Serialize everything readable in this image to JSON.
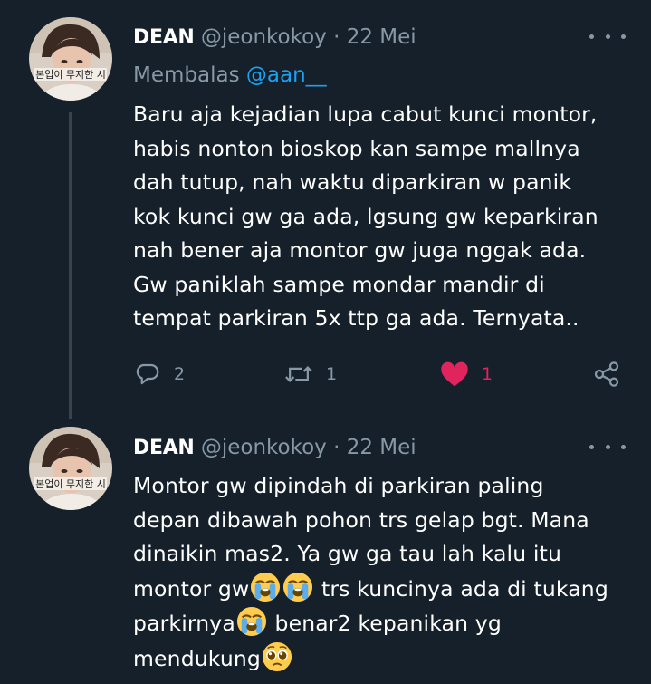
{
  "tweets": [
    {
      "display_name": "DEAN",
      "handle": "@jeonkokoy",
      "separator": "·",
      "date": "22 Mei",
      "reply_prefix": "Membalas",
      "reply_mention": "@aan__",
      "text_lines": [
        "Baru aja kejadian lupa cabut kunci montor,",
        "habis nonton bioskop kan sampe mallnya",
        "dah tutup, nah waktu diparkiran w panik",
        "kok kunci gw ga ada, lgsung gw keparkiran",
        "nah bener aja montor gw juga nggak ada.",
        "Gw paniklah sampe mondar mandir di",
        "tempat parkiran 5x ttp ga ada. Ternyata.."
      ],
      "reply_count": "2",
      "retweet_count": "1",
      "like_count": "1",
      "liked": true
    },
    {
      "display_name": "DEAN",
      "handle": "@jeonkokoy",
      "separator": "·",
      "date": "22 Mei",
      "text_lines": [
        "Montor gw dipindah di parkiran paling",
        "depan dibawah pohon trs gelap bgt. Mana",
        "dinaikin mas2. Ya gw ga tau lah kalu itu"
      ],
      "line4_a": "montor gw",
      "line4_b": " trs kuncinya ada di tukang",
      "line5_a": "parkirnya",
      "line5_b": " benar2 kepanikan yg",
      "line6_a": "mendukung"
    }
  ],
  "colors": {
    "background": "#15202b",
    "text": "#ffffff",
    "secondary": "#8899a6",
    "mention": "#1da1f2",
    "like": "#e0245e",
    "thread_line": "#38444d"
  },
  "icons": [
    "avatar",
    "more-dots-icon",
    "reply-icon",
    "retweet-icon",
    "heart-icon",
    "share-icon",
    "loudly-crying-face-emoji",
    "pleading-face-emoji"
  ]
}
